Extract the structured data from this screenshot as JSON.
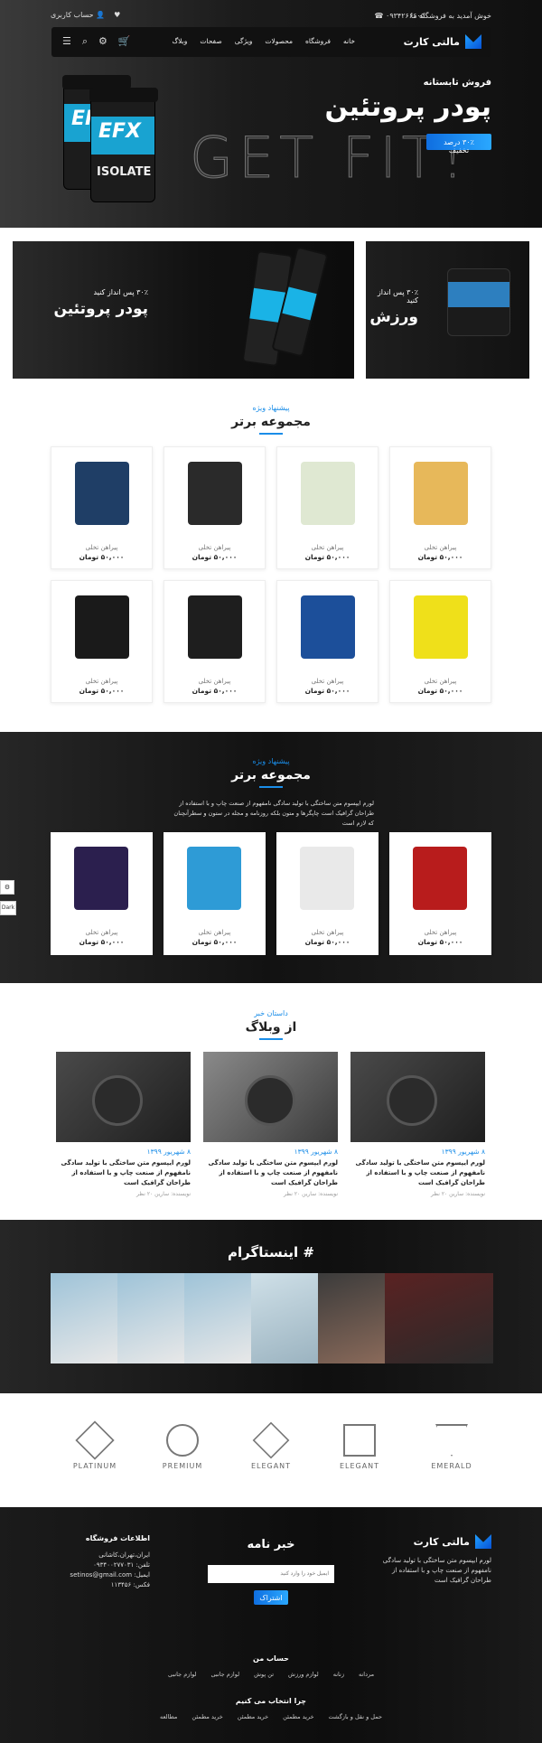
{
  "topbar": {
    "welcome": "خوش آمدید به فروشگاه ما",
    "phone": "۰۹۳۴۲۶۶۶۰۵",
    "account": "حساب کاربری"
  },
  "nav": {
    "logo": "مالتی کارت",
    "menu": [
      "خانه",
      "فروشگاه",
      "محصولات",
      "ویژگی",
      "صفحات",
      "وبلاگ"
    ]
  },
  "hero": {
    "subtitle": "فروش تابستانه",
    "title": "پودر پروتئین",
    "button": "۳۰٪ درصد تخفیف",
    "watermark": "GET FIT!",
    "tub_brand": "EFX",
    "tub_label": "ISOLATE"
  },
  "banners": [
    {
      "small": "۳۰٪ پس انداز کنید",
      "big": "پودر پروتئین"
    },
    {
      "small": "۳۰٪ پس انداز کنید",
      "big": "ورزش"
    }
  ],
  "top_products": {
    "kicker": "پیشنهاد ویژه",
    "title": "مجموعه برتر",
    "items": [
      {
        "name": "پیراهن تخلی",
        "price": "۵۰,۰۰۰ تومان",
        "color": "#e7b85a"
      },
      {
        "name": "پیراهن تخلی",
        "price": "۵۰,۰۰۰ تومان",
        "color": "#dfe8d2"
      },
      {
        "name": "پیراهن تخلی",
        "price": "۵۰,۰۰۰ تومان",
        "color": "#2a2a2a"
      },
      {
        "name": "پیراهن تخلی",
        "price": "۵۰,۰۰۰ تومان",
        "color": "#1f3e66"
      },
      {
        "name": "پیراهن تخلی",
        "price": "۵۰,۰۰۰ تومان",
        "color": "#efe01a"
      },
      {
        "name": "پیراهن تخلی",
        "price": "۵۰,۰۰۰ تومان",
        "color": "#1c4f9a"
      },
      {
        "name": "پیراهن تخلی",
        "price": "۵۰,۰۰۰ تومان",
        "color": "#1e1e1e"
      },
      {
        "name": "پیراهن تخلی",
        "price": "۵۰,۰۰۰ تومان",
        "color": "#1a1a1a"
      }
    ]
  },
  "special": {
    "kicker": "پیشنهاد ویژه",
    "title": "مجموعه برتر",
    "desc": "لورم ایپسوم متن ساختگی با تولید سادگی نامفهوم از صنعت چاپ و با استفاده از طراحان گرافیک است چاپگرها و متون بلکه روزنامه و مجله در ستون و سطرآنچنان که لازم است",
    "items": [
      {
        "name": "پیراهن تخلی",
        "price": "۵۰,۰۰۰ تومان",
        "color": "#b81c1c"
      },
      {
        "name": "پیراهن تخلی",
        "price": "۵۰,۰۰۰ تومان",
        "color": "#e9e9e9"
      },
      {
        "name": "پیراهن تخلی",
        "price": "۵۰,۰۰۰ تومان",
        "color": "#2e9bd6"
      },
      {
        "name": "پیراهن تخلی",
        "price": "۵۰,۰۰۰ تومان",
        "color": "#2b1f4e"
      }
    ]
  },
  "blog": {
    "kicker": "داستان خبر",
    "title": "از وبلاگ",
    "posts": [
      {
        "date": "۸ شهریور ۱۳۹۹",
        "text": "لورم ایپسوم متن ساختگی با تولید سادگی نامفهوم از صنعت چاپ و با استفاده از طراحان گرافیک است",
        "meta": "نویسنده: سارین ۲۰ نظر"
      },
      {
        "date": "۸ شهریور ۱۳۹۹",
        "text": "لورم ایپسوم متن ساختگی با تولید سادگی نامفهوم از صنعت چاپ و با استفاده از طراحان گرافیک است",
        "meta": "نویسنده: سارین ۲۰ نظر"
      },
      {
        "date": "۸ شهریور ۱۳۹۹",
        "text": "لورم ایپسوم متن ساختگی با تولید سادگی نامفهوم از صنعت چاپ و با استفاده از طراحان گرافیک است",
        "meta": "نویسنده: سارین ۲۰ نظر"
      }
    ]
  },
  "instagram": {
    "title": "# اینستاگرام"
  },
  "brands": [
    "EMERALD",
    "ELEGANT",
    "ELEGANT",
    "PREMIUM",
    "PLATINUM"
  ],
  "footer": {
    "logo": "مالتی کارت",
    "about": "لورم ایپسوم متن ساختگی با تولید سادگی نامفهوم از صنعت چاپ و با استفاده از طراحان گرافیک است",
    "newsletter_title": "خبر نامه",
    "newsletter_placeholder": "ایمیل خود را وارد کنید",
    "newsletter_button": "اشتراک",
    "info_title": "اطلاعات فروشگاه",
    "info_lines": [
      "ایران،تهران،کاشانی",
      "تلفن: ۰۹۳۴۰۰۲۷۷۰۳۱",
      "ایمیل: setinos@gmail.com",
      "فکس: ۱۱۳۴۵۶"
    ],
    "account_title": "حساب من",
    "account_links": [
      "مردانه",
      "زنانه",
      "لوازم ورزش",
      "تن پوش",
      "لوازم جانبی",
      "لوازم جانبی"
    ],
    "why_title": "چرا انتخاب می کنیم",
    "why_links": [
      "حمل و نقل و بازگشت",
      "خرید مطمئن",
      "خرید مطمئن",
      "خرید مطمئن",
      "مطالعه"
    ]
  },
  "side_tabs": [
    "⚙",
    "Dark"
  ]
}
